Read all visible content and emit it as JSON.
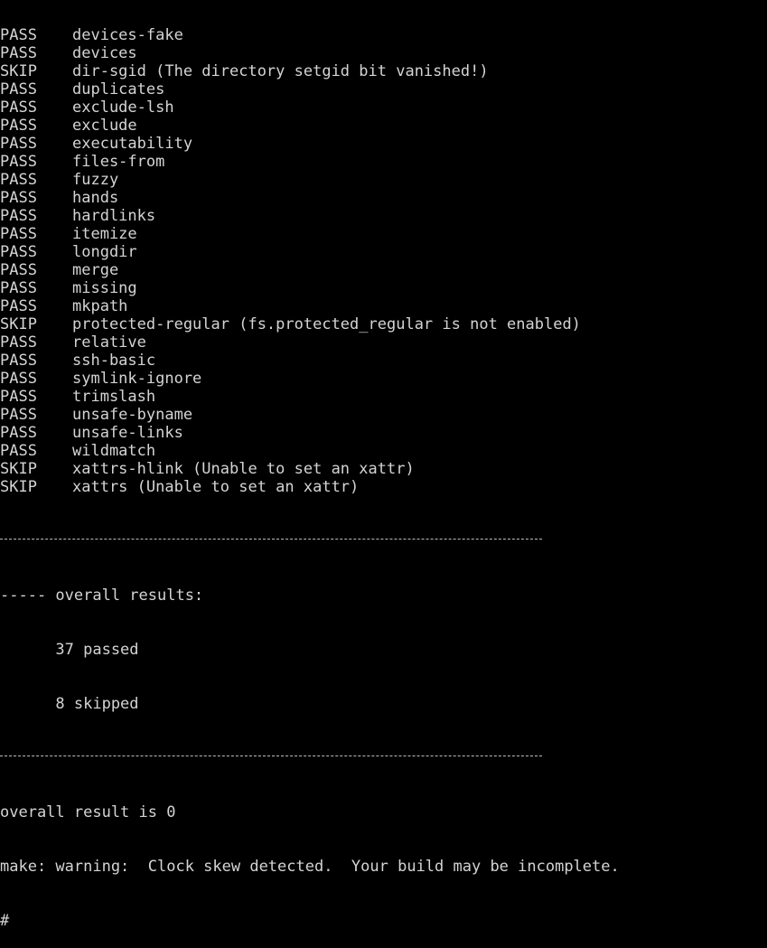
{
  "tests": [
    {
      "status": "PASS",
      "name": "devices-fake"
    },
    {
      "status": "PASS",
      "name": "devices"
    },
    {
      "status": "SKIP",
      "name": "dir-sgid (The directory setgid bit vanished!)"
    },
    {
      "status": "PASS",
      "name": "duplicates"
    },
    {
      "status": "PASS",
      "name": "exclude-lsh"
    },
    {
      "status": "PASS",
      "name": "exclude"
    },
    {
      "status": "PASS",
      "name": "executability"
    },
    {
      "status": "PASS",
      "name": "files-from"
    },
    {
      "status": "PASS",
      "name": "fuzzy"
    },
    {
      "status": "PASS",
      "name": "hands"
    },
    {
      "status": "PASS",
      "name": "hardlinks"
    },
    {
      "status": "PASS",
      "name": "itemize"
    },
    {
      "status": "PASS",
      "name": "longdir"
    },
    {
      "status": "PASS",
      "name": "merge"
    },
    {
      "status": "PASS",
      "name": "missing"
    },
    {
      "status": "PASS",
      "name": "mkpath"
    },
    {
      "status": "SKIP",
      "name": "protected-regular (fs.protected_regular is not enabled)"
    },
    {
      "status": "PASS",
      "name": "relative"
    },
    {
      "status": "PASS",
      "name": "ssh-basic"
    },
    {
      "status": "PASS",
      "name": "symlink-ignore"
    },
    {
      "status": "PASS",
      "name": "trimslash"
    },
    {
      "status": "PASS",
      "name": "unsafe-byname"
    },
    {
      "status": "PASS",
      "name": "unsafe-links"
    },
    {
      "status": "PASS",
      "name": "wildmatch"
    },
    {
      "status": "SKIP",
      "name": "xattrs-hlink (Unable to set an xattr)"
    },
    {
      "status": "SKIP",
      "name": "xattrs (Unable to set an xattr)"
    }
  ],
  "summary": {
    "header": "----- overall results:",
    "passed": "      37 passed",
    "skipped": "      8 skipped"
  },
  "result_line": "overall result is 0",
  "warning_line": "make: warning:  Clock skew detected.  Your build may be incomplete.",
  "prompt": "#"
}
